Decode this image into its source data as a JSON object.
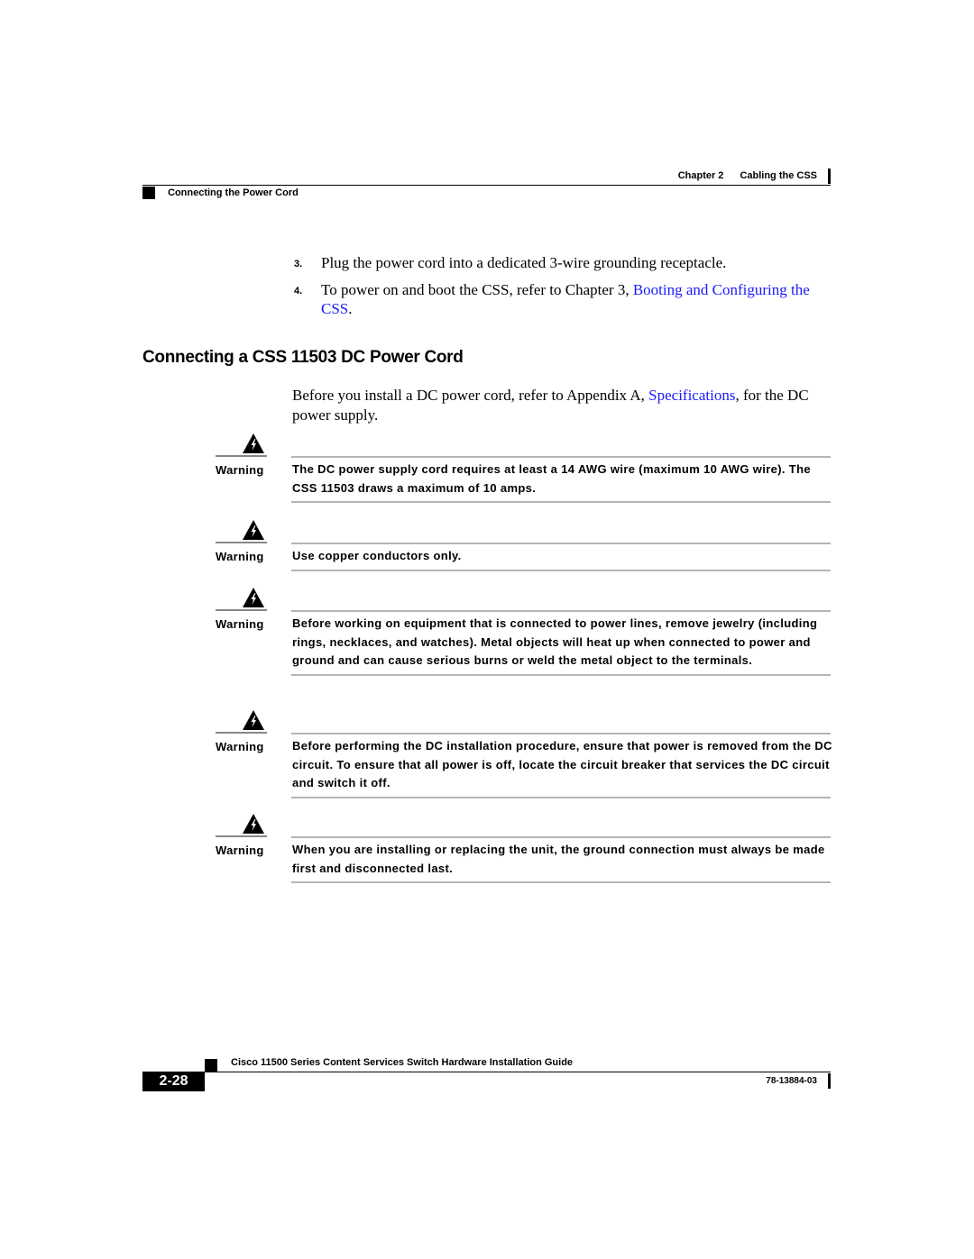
{
  "header": {
    "chapter_label": "Chapter 2",
    "chapter_title": "Cabling the CSS",
    "section_title": "Connecting the Power Cord"
  },
  "steps": [
    {
      "number": "3.",
      "text": "Plug the power cord into a dedicated 3-wire grounding receptacle."
    },
    {
      "number": "4.",
      "text_before": "To power on and boot the CSS, refer to Chapter 3, ",
      "link": "Booting and Configuring the CSS",
      "text_after": "."
    }
  ],
  "section": {
    "heading": "Connecting a CSS 11503 DC Power Cord",
    "intro_before": "Before you install a DC power cord, refer to Appendix A, ",
    "intro_link": "Specifications",
    "intro_after": ", for the DC power supply."
  },
  "warnings": [
    {
      "icon": "warning-triangle-icon",
      "label": "Warning",
      "text": "The DC power supply cord requires at least a 14 AWG wire (maximum 10 AWG wire). The CSS 11503 draws a maximum of 10 amps."
    },
    {
      "icon": "warning-triangle-icon",
      "label": "Warning",
      "text": "Use copper conductors only."
    },
    {
      "icon": "warning-triangle-icon",
      "label": "Warning",
      "text": "Before working on equipment that is connected to power lines, remove jewelry (including rings, necklaces, and watches). Metal objects will heat up when connected to power and ground and can cause serious burns or weld the metal object to the terminals."
    },
    {
      "icon": "warning-triangle-icon",
      "label": "Warning",
      "text": "Before performing the DC installation procedure, ensure that power is removed from the DC circuit. To ensure that all power is off, locate the circuit breaker that services the DC circuit and switch it off."
    },
    {
      "icon": "warning-triangle-icon",
      "label": "Warning",
      "text": "When you are installing or replacing the unit, the ground connection must always be made first and disconnected last."
    }
  ],
  "footer": {
    "book_title": "Cisco 11500 Series Content Services Switch Hardware Installation Guide",
    "page_number": "2-28",
    "doc_number": "78-13884-03"
  },
  "colors": {
    "link": "#1a1aff",
    "text": "#000000",
    "rule_gray": "#b5b5b5"
  }
}
